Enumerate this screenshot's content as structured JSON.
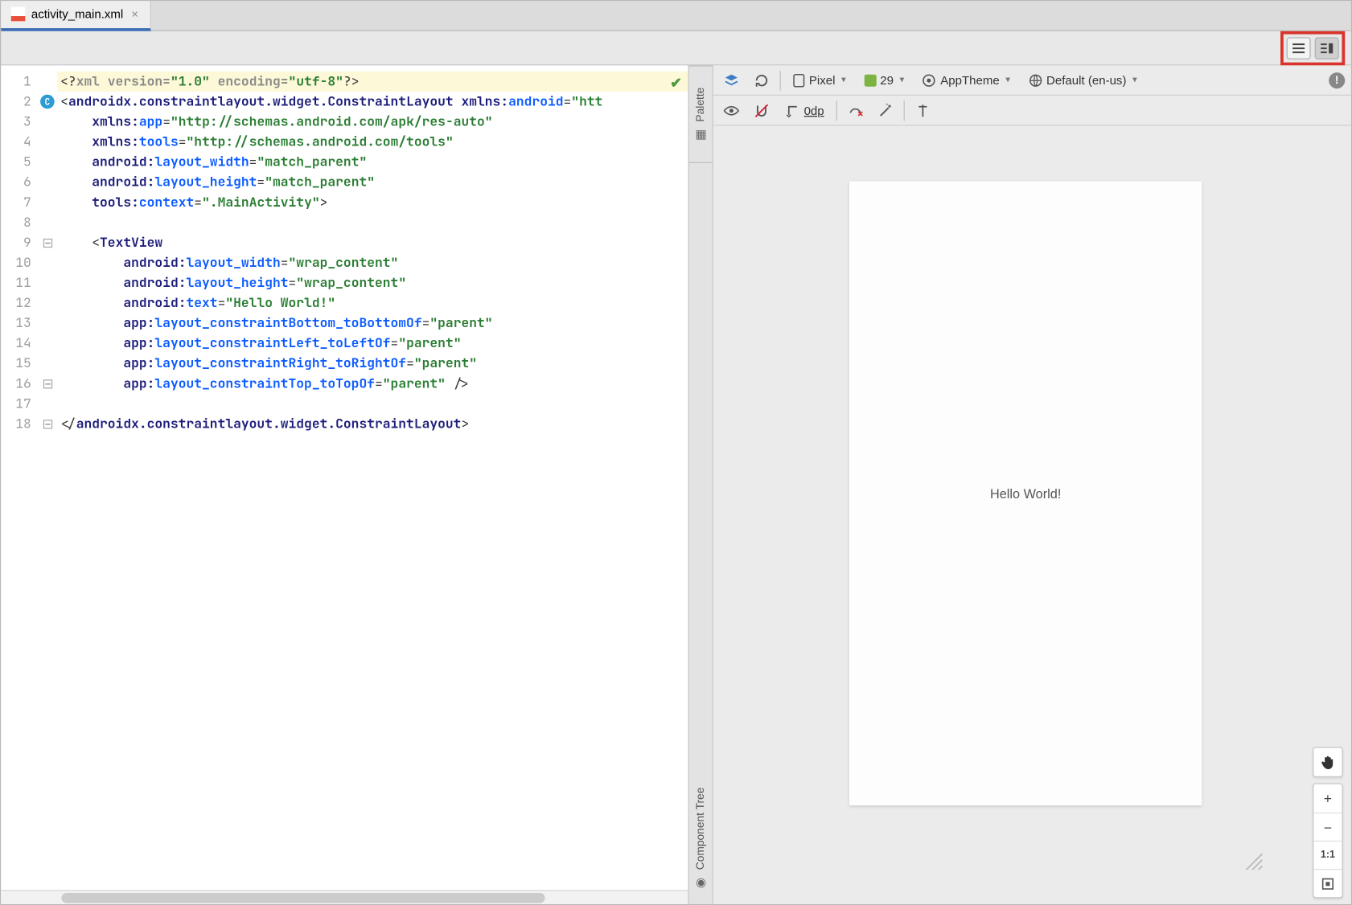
{
  "tab": {
    "filename": "activity_main.xml"
  },
  "viewmodes": {
    "code": "code-only",
    "split": "split-view"
  },
  "code": {
    "lines": [
      {
        "n": 1,
        "hl": true,
        "html": "<span class='punc'>&lt;?</span><span class='pi'>xml version=</span><span class='str'>\"1.0\"</span> <span class='pi'>encoding=</span><span class='str'>\"utf-8\"</span><span class='punc'>?&gt;</span>"
      },
      {
        "n": 2,
        "mark": "c",
        "html": "<span class='punc'>&lt;</span><span class='txt'>androidx.constraintlayout.widget.ConstraintLayout</span> <span class='ns'>xmlns:</span><span class='attr'>android</span><span class='punc'>=</span><span class='str'>\"htt</span>"
      },
      {
        "n": 3,
        "html": "    <span class='ns'>xmlns:</span><span class='attr'>app</span><span class='punc'>=</span><span class='str'>\"http://schemas.android.com/apk/res-auto\"</span>"
      },
      {
        "n": 4,
        "html": "    <span class='ns'>xmlns:</span><span class='attr'>tools</span><span class='punc'>=</span><span class='str'>\"http://schemas.android.com/tools\"</span>"
      },
      {
        "n": 5,
        "html": "    <span class='ns'>android:</span><span class='attr'>layout_width</span><span class='punc'>=</span><span class='str'>\"match_parent\"</span>"
      },
      {
        "n": 6,
        "html": "    <span class='ns'>android:</span><span class='attr'>layout_height</span><span class='punc'>=</span><span class='str'>\"match_parent\"</span>"
      },
      {
        "n": 7,
        "html": "    <span class='ns'>tools:</span><span class='attr'>context</span><span class='punc'>=</span><span class='str'>\".MainActivity\"</span><span class='punc'>&gt;</span>"
      },
      {
        "n": 8,
        "html": ""
      },
      {
        "n": 9,
        "mark": "fold",
        "html": "    <span class='punc'>&lt;</span><span class='txt'>TextView</span>"
      },
      {
        "n": 10,
        "html": "        <span class='ns'>android:</span><span class='attr'>layout_width</span><span class='punc'>=</span><span class='str'>\"wrap_content\"</span>"
      },
      {
        "n": 11,
        "html": "        <span class='ns'>android:</span><span class='attr'>layout_height</span><span class='punc'>=</span><span class='str'>\"wrap_content\"</span>"
      },
      {
        "n": 12,
        "html": "        <span class='ns'>android:</span><span class='attr'>text</span><span class='punc'>=</span><span class='str'>\"Hello World!\"</span>"
      },
      {
        "n": 13,
        "html": "        <span class='ns'>app:</span><span class='attr'>layout_constraintBottom_toBottomOf</span><span class='punc'>=</span><span class='str'>\"parent\"</span>"
      },
      {
        "n": 14,
        "html": "        <span class='ns'>app:</span><span class='attr'>layout_constraintLeft_toLeftOf</span><span class='punc'>=</span><span class='str'>\"parent\"</span>"
      },
      {
        "n": 15,
        "html": "        <span class='ns'>app:</span><span class='attr'>layout_constraintRight_toRightOf</span><span class='punc'>=</span><span class='str'>\"parent\"</span>"
      },
      {
        "n": 16,
        "mark": "foldend",
        "html": "        <span class='ns'>app:</span><span class='attr'>layout_constraintTop_toTopOf</span><span class='punc'>=</span><span class='str'>\"parent\"</span> <span class='punc'>/&gt;</span>"
      },
      {
        "n": 17,
        "html": ""
      },
      {
        "n": 18,
        "mark": "foldend",
        "html": "<span class='punc'>&lt;/</span><span class='txt'>androidx.constraintlayout.widget.ConstraintLayout</span><span class='punc'>&gt;</span>"
      }
    ]
  },
  "side_tabs": {
    "palette": "Palette",
    "component_tree": "Component Tree"
  },
  "preview_toolbar": {
    "device_label": "Pixel",
    "api_label": "29",
    "theme_label": "AppTheme",
    "locale_label": "Default (en-us)",
    "margin_label": "0dp"
  },
  "device_preview": {
    "text": "Hello World!"
  },
  "zoom": {
    "ratio": "1:1"
  }
}
